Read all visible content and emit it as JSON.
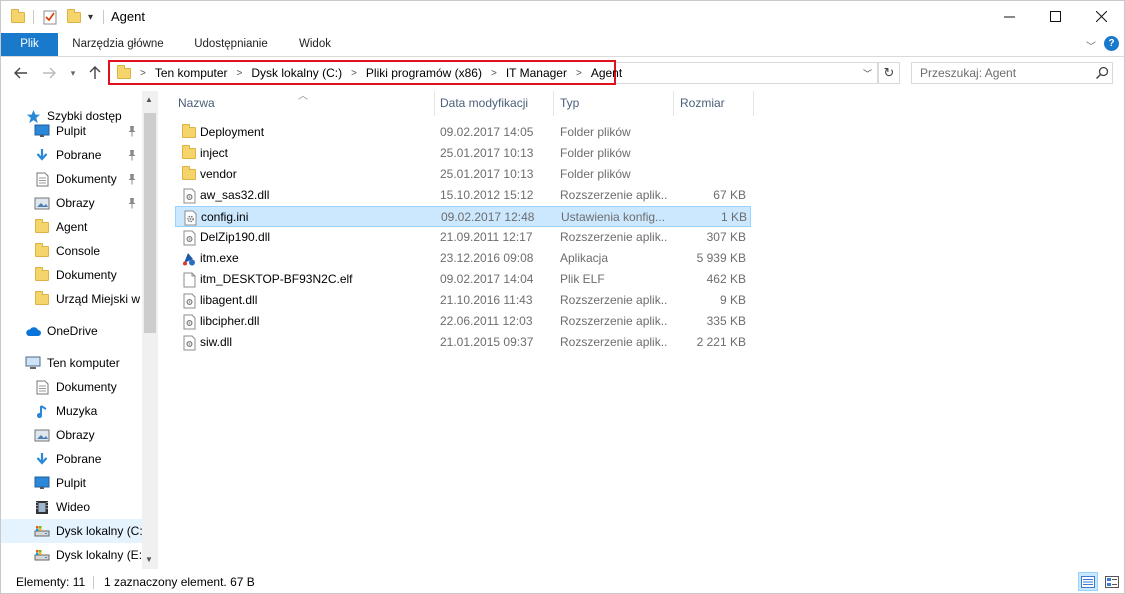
{
  "window": {
    "title": "Agent"
  },
  "ribbon": {
    "tabs": [
      {
        "label": "Plik"
      },
      {
        "label": "Narzędzia główne"
      },
      {
        "label": "Udostępnianie"
      },
      {
        "label": "Widok"
      }
    ],
    "help_label": "?"
  },
  "address": {
    "breadcrumbs": [
      "Ten komputer",
      "Dysk lokalny (C:)",
      "Pliki programów (x86)",
      "IT Manager",
      "Agent"
    ],
    "separator": ">"
  },
  "search": {
    "placeholder": "Przeszukaj: Agent"
  },
  "nav": {
    "items": [
      {
        "label": "Szybki dostęp",
        "icon": "star-icon",
        "indent": 1,
        "pinned": false
      },
      {
        "label": "Pulpit",
        "icon": "desktop-icon",
        "indent": 2,
        "pinned": true
      },
      {
        "label": "Pobrane",
        "icon": "download-icon",
        "indent": 2,
        "pinned": true
      },
      {
        "label": "Dokumenty",
        "icon": "documents-icon",
        "indent": 2,
        "pinned": true
      },
      {
        "label": "Obrazy",
        "icon": "pictures-icon",
        "indent": 2,
        "pinned": true
      },
      {
        "label": "Agent",
        "icon": "folder-icon",
        "indent": 2,
        "pinned": false
      },
      {
        "label": "Console",
        "icon": "folder-icon",
        "indent": 2,
        "pinned": false
      },
      {
        "label": "Dokumenty",
        "icon": "folder-icon",
        "indent": 2,
        "pinned": false
      },
      {
        "label": "Urząd Miejski w",
        "icon": "folder-icon",
        "indent": 2,
        "pinned": false
      },
      {
        "label": "OneDrive",
        "icon": "cloud-icon",
        "indent": 1,
        "pinned": false
      },
      {
        "label": "Ten komputer",
        "icon": "computer-icon",
        "indent": 1,
        "pinned": false
      },
      {
        "label": "Dokumenty",
        "icon": "documents-icon",
        "indent": 2,
        "pinned": false
      },
      {
        "label": "Muzyka",
        "icon": "music-icon",
        "indent": 2,
        "pinned": false
      },
      {
        "label": "Obrazy",
        "icon": "pictures-icon",
        "indent": 2,
        "pinned": false
      },
      {
        "label": "Pobrane",
        "icon": "download-icon",
        "indent": 2,
        "pinned": false
      },
      {
        "label": "Pulpit",
        "icon": "desktop-icon",
        "indent": 2,
        "pinned": false
      },
      {
        "label": "Wideo",
        "icon": "video-icon",
        "indent": 2,
        "pinned": false
      },
      {
        "label": "Dysk lokalny (C:)",
        "icon": "drive-icon",
        "indent": 2,
        "pinned": false,
        "selected": true
      },
      {
        "label": "Dysk lokalny (E:)",
        "icon": "drive-icon",
        "indent": 2,
        "pinned": false
      }
    ]
  },
  "columns": {
    "name": "Nazwa",
    "date": "Data modyfikacji",
    "type": "Typ",
    "size": "Rozmiar"
  },
  "files": [
    {
      "name": "Deployment",
      "date": "09.02.2017 14:05",
      "type": "Folder plików",
      "size": "",
      "icon": "folder-icon"
    },
    {
      "name": "inject",
      "date": "25.01.2017 10:13",
      "type": "Folder plików",
      "size": "",
      "icon": "folder-icon"
    },
    {
      "name": "vendor",
      "date": "25.01.2017 10:13",
      "type": "Folder plików",
      "size": "",
      "icon": "folder-icon"
    },
    {
      "name": "aw_sas32.dll",
      "date": "15.10.2012 15:12",
      "type": "Rozszerzenie aplik...",
      "size": "67 KB",
      "icon": "dll-icon"
    },
    {
      "name": "config.ini",
      "date": "09.02.2017 12:48",
      "type": "Ustawienia konfig...",
      "size": "1 KB",
      "icon": "settings-file-icon",
      "selected": true
    },
    {
      "name": "DelZip190.dll",
      "date": "21.09.2011 12:17",
      "type": "Rozszerzenie aplik...",
      "size": "307 KB",
      "icon": "dll-icon"
    },
    {
      "name": "itm.exe",
      "date": "23.12.2016 09:08",
      "type": "Aplikacja",
      "size": "5 939 KB",
      "icon": "exe-icon"
    },
    {
      "name": "itm_DESKTOP-BF93N2C.elf",
      "date": "09.02.2017 14:04",
      "type": "Plik ELF",
      "size": "462 KB",
      "icon": "file-icon"
    },
    {
      "name": "libagent.dll",
      "date": "21.10.2016 11:43",
      "type": "Rozszerzenie aplik...",
      "size": "9 KB",
      "icon": "dll-icon"
    },
    {
      "name": "libcipher.dll",
      "date": "22.06.2011 12:03",
      "type": "Rozszerzenie aplik...",
      "size": "335 KB",
      "icon": "dll-icon"
    },
    {
      "name": "siw.dll",
      "date": "21.01.2015 09:37",
      "type": "Rozszerzenie aplik...",
      "size": "2 221 KB",
      "icon": "dll-icon"
    }
  ],
  "status": {
    "count": "Elementy: 11",
    "selection": "1 zaznaczony element. 67 B"
  },
  "colors": {
    "accent": "#1979ca",
    "selection_bg": "#cce8ff",
    "selection_border": "#99d1ff",
    "highlight_border": "#e0101d",
    "folder": "#f5d46b"
  }
}
